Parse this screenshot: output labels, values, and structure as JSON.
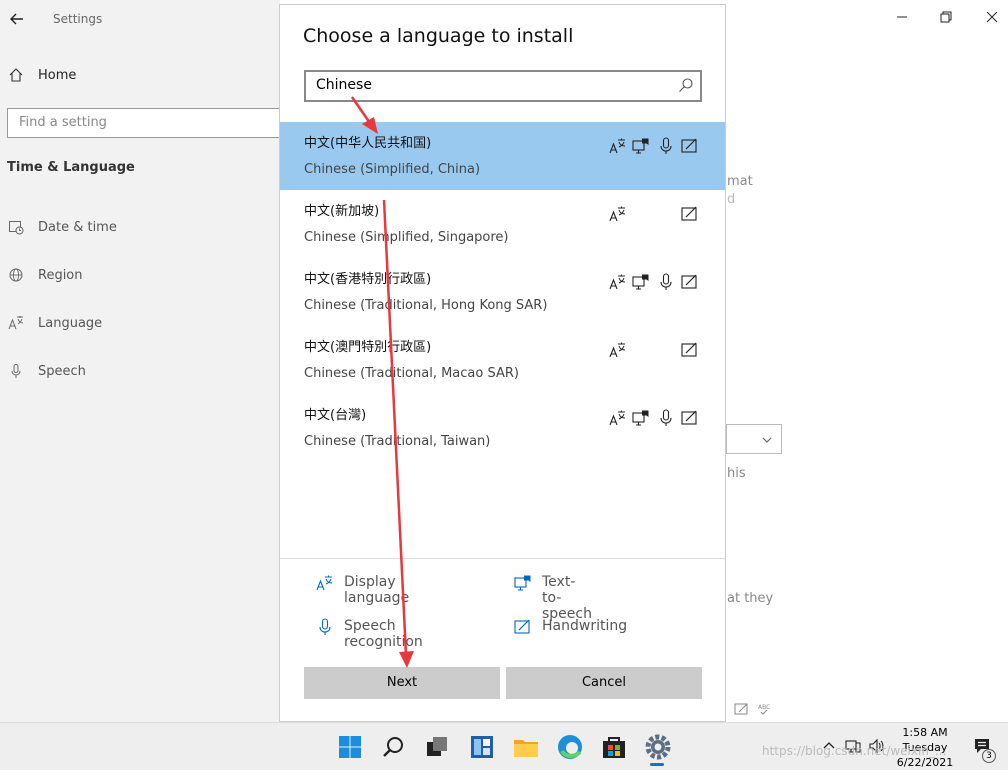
{
  "settings": {
    "app_title": "Settings",
    "home_label": "Home",
    "search_placeholder": "Find a setting",
    "section_title": "Time & Language",
    "nav": [
      {
        "label": "Date & time"
      },
      {
        "label": "Region"
      },
      {
        "label": "Language"
      },
      {
        "label": "Speech"
      }
    ],
    "bg_texts": [
      "mat",
      "d",
      "his",
      "at they"
    ]
  },
  "dialog": {
    "title": "Choose a language to install",
    "search_value": "Chinese",
    "languages": [
      {
        "native": "中文(中华人民共和国)",
        "english": "Chinese (Simplified, China)",
        "features": [
          "display-language-icon",
          "text-to-speech-icon",
          "speech-recognition-icon",
          "handwriting-icon"
        ],
        "selected": true
      },
      {
        "native": "中文(新加坡)",
        "english": "Chinese (Simplified, Singapore)",
        "features": [
          "display-language-icon",
          "handwriting-icon"
        ],
        "selected": false
      },
      {
        "native": "中文(香港特別行政區)",
        "english": "Chinese (Traditional, Hong Kong SAR)",
        "features": [
          "display-language-icon",
          "text-to-speech-icon",
          "speech-recognition-icon",
          "handwriting-icon"
        ],
        "selected": false
      },
      {
        "native": "中文(澳門特別行政區)",
        "english": "Chinese (Traditional, Macao SAR)",
        "features": [
          "display-language-icon",
          "handwriting-icon"
        ],
        "selected": false
      },
      {
        "native": "中文(台灣)",
        "english": "Chinese (Traditional, Taiwan)",
        "features": [
          "display-language-icon",
          "text-to-speech-icon",
          "speech-recognition-icon",
          "handwriting-icon"
        ],
        "selected": false
      }
    ],
    "legend": {
      "display_language": "Display language",
      "text_to_speech": "Text-to-speech",
      "speech_recognition": "Speech recognition",
      "handwriting": "Handwriting"
    },
    "next_label": "Next",
    "cancel_label": "Cancel"
  },
  "taskbar": {
    "clock_time": "1:58 AM",
    "clock_day": "Tuesday",
    "clock_date": "6/22/2021",
    "apps": [
      "start-icon",
      "search-icon",
      "task-view-icon",
      "widgets-icon",
      "file-explorer-icon",
      "edge-icon",
      "store-icon",
      "settings-icon"
    ],
    "notification_count": "3"
  },
  "watermark": "https://blog.csdn.net/weixin_...",
  "colors": {
    "selected_bg": "#99c9ee",
    "accent": "#0078d4",
    "annotation_arrow": "#e8383d"
  }
}
